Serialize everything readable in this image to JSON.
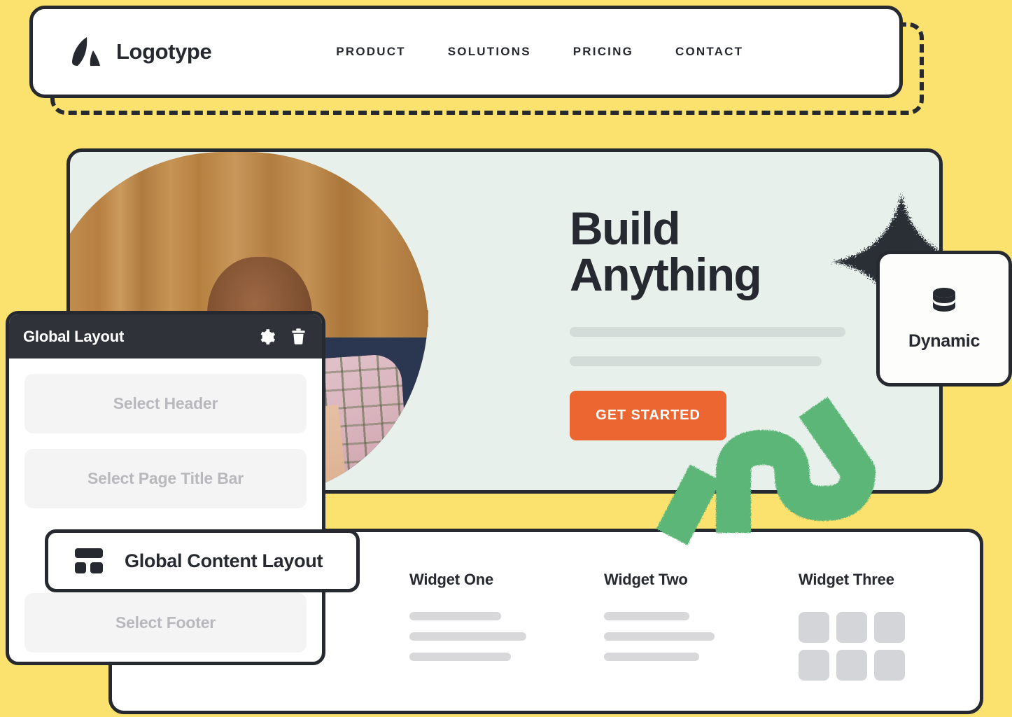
{
  "theme": {
    "page_background": "#fbe26f",
    "ink": "#26292f",
    "hero_background": "#e8f0ec",
    "accent_orange": "#ec6632",
    "accent_green": "#5cb678",
    "panel_header": "#2f3339",
    "skeleton_grey": "#d8d8da"
  },
  "header": {
    "logo_icon": "logo-mark-icon",
    "brand": "Logotype",
    "nav": [
      {
        "label": "PRODUCT"
      },
      {
        "label": "SOLUTIONS"
      },
      {
        "label": "PRICING"
      },
      {
        "label": "CONTACT"
      }
    ]
  },
  "hero": {
    "photo_alt": "smiling-woman-with-curly-hair-at-laptop",
    "title_line_1": "Build",
    "title_line_2": "Anything",
    "cta_label": "GET STARTED",
    "skeleton_lines": 2
  },
  "dynamic_card": {
    "icon": "database-icon",
    "label": "Dynamic"
  },
  "widgets": [
    {
      "title": "Widget One",
      "type": "lines",
      "line_widths": [
        "58%",
        "73%",
        "65%"
      ]
    },
    {
      "title": "Widget Two",
      "type": "lines",
      "line_widths": [
        "53%",
        "70%",
        "58%"
      ]
    },
    {
      "title": "Widget Three",
      "type": "grid",
      "grid_cells": 6
    }
  ],
  "global_layout_panel": {
    "title": "Global Layout",
    "gear_icon": "gear-icon",
    "trash_icon": "trash-icon",
    "slots": [
      {
        "label": "Select Header"
      },
      {
        "label": "Select Page Title Bar"
      },
      {
        "label": "Select Footer"
      }
    ]
  },
  "global_content_layout": {
    "icon": "layout-grid-icon",
    "label": "Global Content Layout"
  }
}
